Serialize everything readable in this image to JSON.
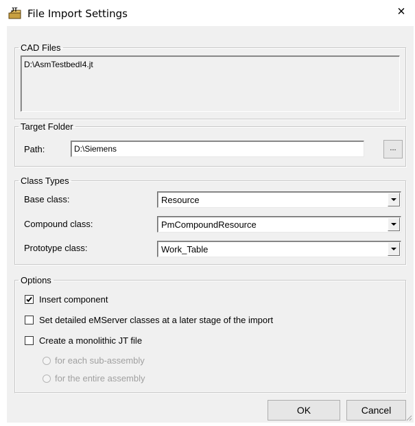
{
  "window": {
    "title": "File Import Settings",
    "close_glyph": "×",
    "icon": "jt-import-icon",
    "icon_caption": "JT"
  },
  "cad_files": {
    "legend": "CAD Files",
    "items": [
      "D:\\AsmTestbedI4.jt"
    ]
  },
  "target_folder": {
    "legend": "Target Folder",
    "path_label": "Path:",
    "path_value": "D:\\Siemens",
    "browse_label": "..."
  },
  "class_types": {
    "legend": "Class Types",
    "base_label": "Base class:",
    "base_value": "Resource",
    "compound_label": "Compound class:",
    "compound_value": "PmCompoundResource",
    "prototype_label": "Prototype class:",
    "prototype_value": "Work_Table"
  },
  "options": {
    "legend": "Options",
    "insert_component": {
      "label": "Insert component",
      "checked": true
    },
    "set_detailed": {
      "label": "Set detailed eMServer classes at a later stage of the import",
      "checked": false
    },
    "monolithic": {
      "label": "Create a monolithic JT file",
      "checked": false
    },
    "radio_sub": {
      "label": "for each sub-assembly",
      "enabled": false
    },
    "radio_entire": {
      "label": "for the entire assembly",
      "enabled": false
    }
  },
  "buttons": {
    "ok": "OK",
    "cancel": "Cancel"
  }
}
